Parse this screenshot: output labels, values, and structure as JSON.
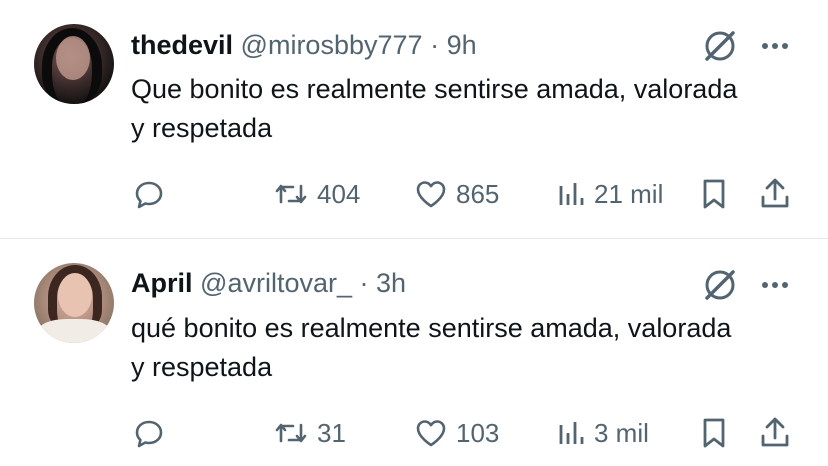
{
  "tweets": [
    {
      "author_name": "thedevil",
      "handle": "@mirosbby777",
      "separator": "·",
      "time": "9h",
      "text": "Que bonito es realmente sentirse amada, valorada y respetada",
      "retweets": "404",
      "likes": "865",
      "views": "21 mil"
    },
    {
      "author_name": "April",
      "handle": "@avriltovar_",
      "separator": "·",
      "time": "3h",
      "text": "qué bonito es realmente sentirse amada, valorada y respetada",
      "retweets": "31",
      "likes": "103",
      "views": "3 mil"
    }
  ],
  "icons": {
    "reply": "reply-icon",
    "retweet": "retweet-icon",
    "like": "heart-icon",
    "views": "views-icon",
    "bookmark": "bookmark-icon",
    "share": "share-icon",
    "grok": "grok-icon",
    "more": "more-icon"
  },
  "colors": {
    "text": "#0f1419",
    "secondary": "#536471",
    "divider": "#e6e9ec"
  }
}
